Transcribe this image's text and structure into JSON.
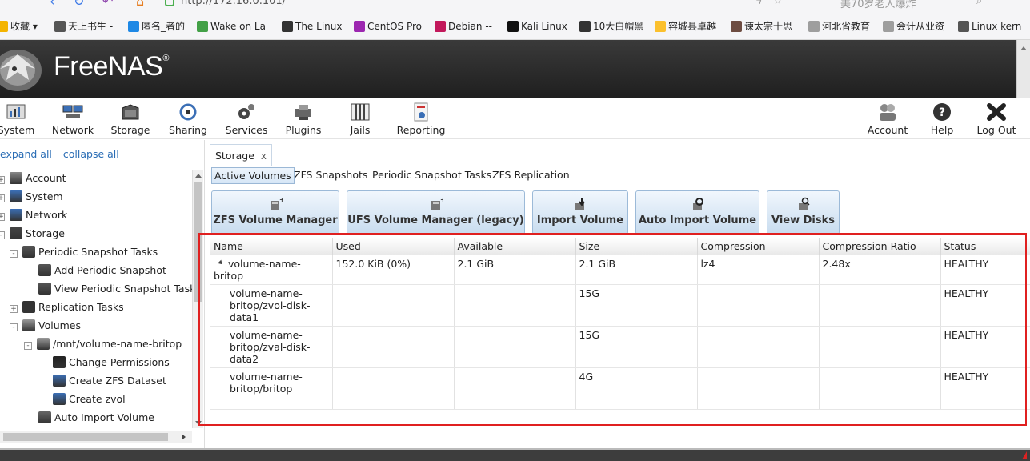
{
  "browser": {
    "url": "http://172.16.0.101/",
    "right_text": "美70岁老人爆炸"
  },
  "bookmarks": [
    {
      "label": "收藏 ▾",
      "icon": "star-icon",
      "color": "#f4b400"
    },
    {
      "label": "天上书生 -",
      "icon": "cursive-v-icon",
      "color": "#555555"
    },
    {
      "label": "匿名_者的",
      "icon": "tile-icon",
      "color": "#1e88e5"
    },
    {
      "label": "Wake on La",
      "icon": "green-square-icon",
      "color": "#43a047"
    },
    {
      "label": "The Linux",
      "icon": "tux-icon",
      "color": "#333333"
    },
    {
      "label": "CentOS Pro",
      "icon": "centos-icon",
      "color": "#9c27b0"
    },
    {
      "label": "Debian --",
      "icon": "debian-icon",
      "color": "#c2185b"
    },
    {
      "label": "Kali Linux",
      "icon": "kali-icon",
      "color": "#111111"
    },
    {
      "label": "10大白帽黑",
      "icon": "hat-icon",
      "color": "#333333"
    },
    {
      "label": "容城县卓越",
      "icon": "logo-icon",
      "color": "#fbc02d"
    },
    {
      "label": "谏太宗十思",
      "icon": "portrait-icon",
      "color": "#6d4c41"
    },
    {
      "label": "河北省教育",
      "icon": "page-icon",
      "color": "#9e9e9e"
    },
    {
      "label": "会计从业资",
      "icon": "page-icon",
      "color": "#9e9e9e"
    },
    {
      "label": "Linux kern",
      "icon": "cursive-v-icon",
      "color": "#555555"
    }
  ],
  "brand": {
    "name": "FreeNAS",
    "mark": "®"
  },
  "toolbar": {
    "left": [
      {
        "label": "System",
        "icon": "system-icon"
      },
      {
        "label": "Network",
        "icon": "network-icon"
      },
      {
        "label": "Storage",
        "icon": "storage-icon"
      },
      {
        "label": "Sharing",
        "icon": "sharing-icon"
      },
      {
        "label": "Services",
        "icon": "services-icon"
      },
      {
        "label": "Plugins",
        "icon": "plugins-icon"
      },
      {
        "label": "Jails",
        "icon": "jails-icon"
      },
      {
        "label": "Reporting",
        "icon": "reporting-icon"
      }
    ],
    "right": [
      {
        "label": "Account",
        "icon": "account-icon"
      },
      {
        "label": "Help",
        "icon": "help-icon"
      },
      {
        "label": "Log Out",
        "icon": "logout-icon"
      }
    ]
  },
  "tree": {
    "expand_all": "expand all",
    "collapse_all": "collapse all",
    "items": [
      {
        "label": "Account",
        "icon": "account-icon",
        "expander": "+"
      },
      {
        "label": "System",
        "icon": "system-icon",
        "expander": "+"
      },
      {
        "label": "Network",
        "icon": "network-icon",
        "expander": "+"
      },
      {
        "label": "Storage",
        "icon": "storage-icon",
        "expander": "-"
      },
      {
        "label": "Periodic Snapshot Tasks",
        "icon": "clock-icon",
        "expander": "-"
      },
      {
        "label": "Add Periodic Snapshot",
        "icon": "clock-add-icon",
        "expander": ""
      },
      {
        "label": "View Periodic Snapshot Tasks",
        "icon": "clock-view-icon",
        "expander": ""
      },
      {
        "label": "Replication Tasks",
        "icon": "replication-icon",
        "expander": "+"
      },
      {
        "label": "Volumes",
        "icon": "volume-icon",
        "expander": "-"
      },
      {
        "label": "/mnt/volume-name-britop",
        "icon": "volume-icon",
        "expander": "-"
      },
      {
        "label": "Change Permissions",
        "icon": "key-icon",
        "expander": ""
      },
      {
        "label": "Create ZFS Dataset",
        "icon": "dataset-icon",
        "expander": ""
      },
      {
        "label": "Create zvol",
        "icon": "zvol-icon",
        "expander": ""
      },
      {
        "label": "Auto Import Volume",
        "icon": "import-icon",
        "expander": ""
      }
    ]
  },
  "tab": {
    "label": "Storage",
    "close": "x"
  },
  "subtabs": [
    "Active Volumes",
    "ZFS Snapshots",
    "Periodic Snapshot Tasks",
    "ZFS Replication"
  ],
  "action_buttons": [
    {
      "label": "ZFS Volume Manager",
      "icon": "volume-add-icon"
    },
    {
      "label": "UFS Volume Manager (legacy)",
      "icon": "volume-add-icon"
    },
    {
      "label": "Import Volume",
      "icon": "import-icon"
    },
    {
      "label": "Auto Import Volume",
      "icon": "auto-import-icon"
    },
    {
      "label": "View Disks",
      "icon": "view-disks-icon"
    }
  ],
  "grid": {
    "columns": [
      "Name",
      "Used",
      "Available",
      "Size",
      "Compression",
      "Compression Ratio",
      "Status"
    ],
    "rows": [
      {
        "name": "volume-name-britop",
        "used": "152.0 KiB (0%)",
        "available": "2.1 GiB",
        "size": "2.1 GiB",
        "compression": "lz4",
        "ratio": "2.48x",
        "status": "HEALTHY"
      },
      {
        "name": "volume-name-britop/zvol-disk-data1",
        "used": "",
        "available": "",
        "size": "15G",
        "compression": "",
        "ratio": "",
        "status": "HEALTHY"
      },
      {
        "name": "volume-name-britop/zval-disk-data2",
        "used": "",
        "available": "",
        "size": "15G",
        "compression": "",
        "ratio": "",
        "status": "HEALTHY"
      },
      {
        "name": "volume-name-britop/britop",
        "used": "",
        "available": "",
        "size": "4G",
        "compression": "",
        "ratio": "",
        "status": "HEALTHY"
      }
    ]
  },
  "colors": {
    "highlight": "#e02020",
    "link": "#2a6db5",
    "header_bg": "#2b2b2b"
  }
}
